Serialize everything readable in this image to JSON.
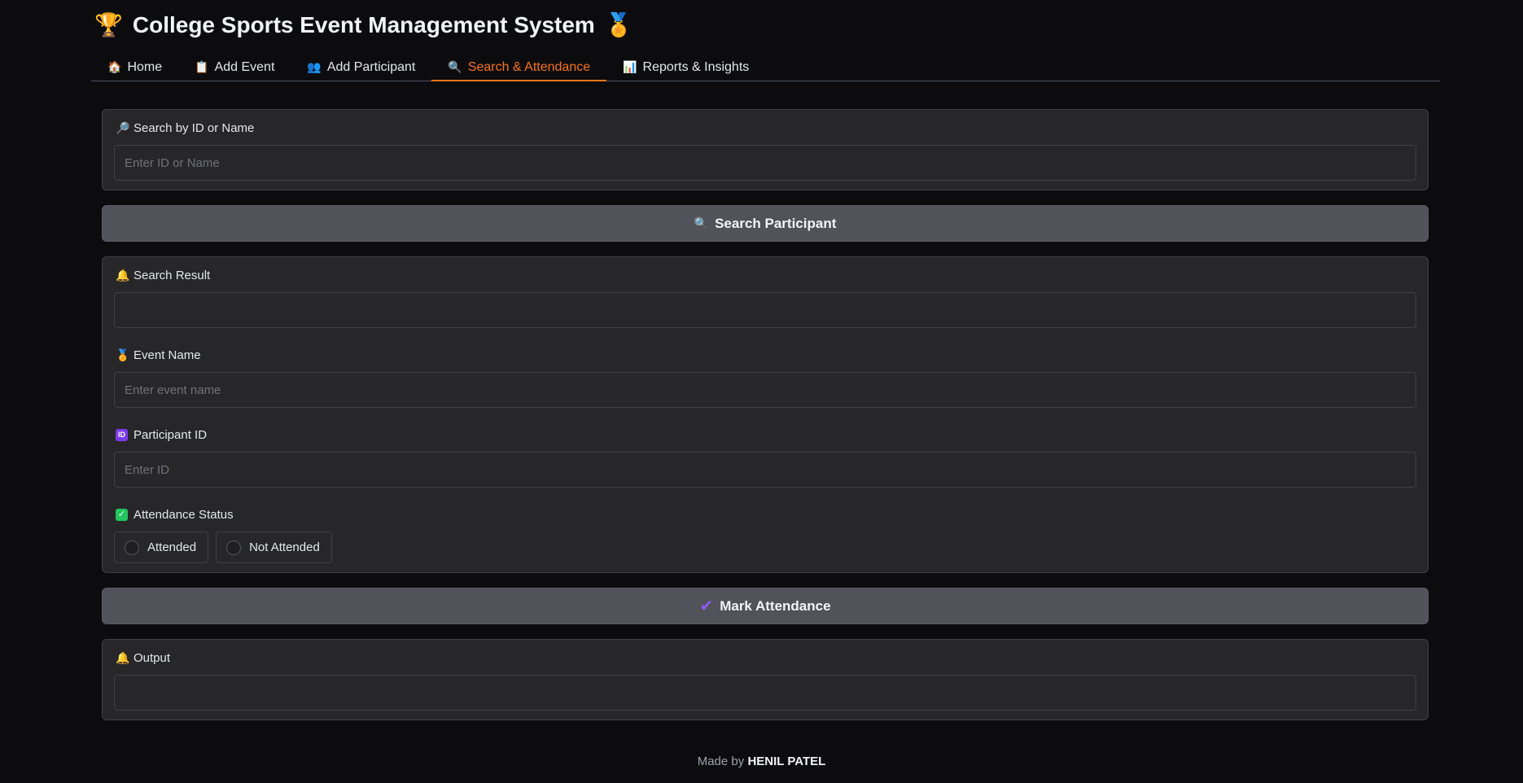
{
  "app": {
    "title": "College Sports Event Management System",
    "title_icon_left": "trophy-icon",
    "title_icon_right": "medal-icon"
  },
  "tabs": [
    {
      "label": "Home",
      "icon": "house-icon",
      "active": false
    },
    {
      "label": "Add Event",
      "icon": "clipboard-icon",
      "active": false
    },
    {
      "label": "Add Participant",
      "icon": "people-icon",
      "active": false
    },
    {
      "label": "Search & Attendance",
      "icon": "magnifier-icon",
      "active": true
    },
    {
      "label": "Reports & Insights",
      "icon": "bar-chart-icon",
      "active": false
    }
  ],
  "search": {
    "label": "Search by ID or Name",
    "placeholder": "Enter ID or Name",
    "value": ""
  },
  "search_button": {
    "label": "Search Participant"
  },
  "result": {
    "label": "Search Result",
    "value": ""
  },
  "event_name": {
    "label": "Event Name",
    "placeholder": "Enter event name",
    "value": ""
  },
  "participant_id": {
    "label": "Participant ID",
    "placeholder": "Enter ID",
    "value": ""
  },
  "attendance": {
    "label": "Attendance Status",
    "options": [
      "Attended",
      "Not Attended"
    ],
    "selected": null
  },
  "mark_button": {
    "label": "Mark Attendance"
  },
  "output": {
    "label": "Output",
    "value": ""
  },
  "footer": {
    "prefix": "Made by",
    "author": "HENIL PATEL"
  },
  "colors": {
    "background": "#0c0c0f",
    "panel": "#27272a",
    "border": "#3f3f46",
    "button": "#52525b",
    "accent": "#f97316"
  }
}
